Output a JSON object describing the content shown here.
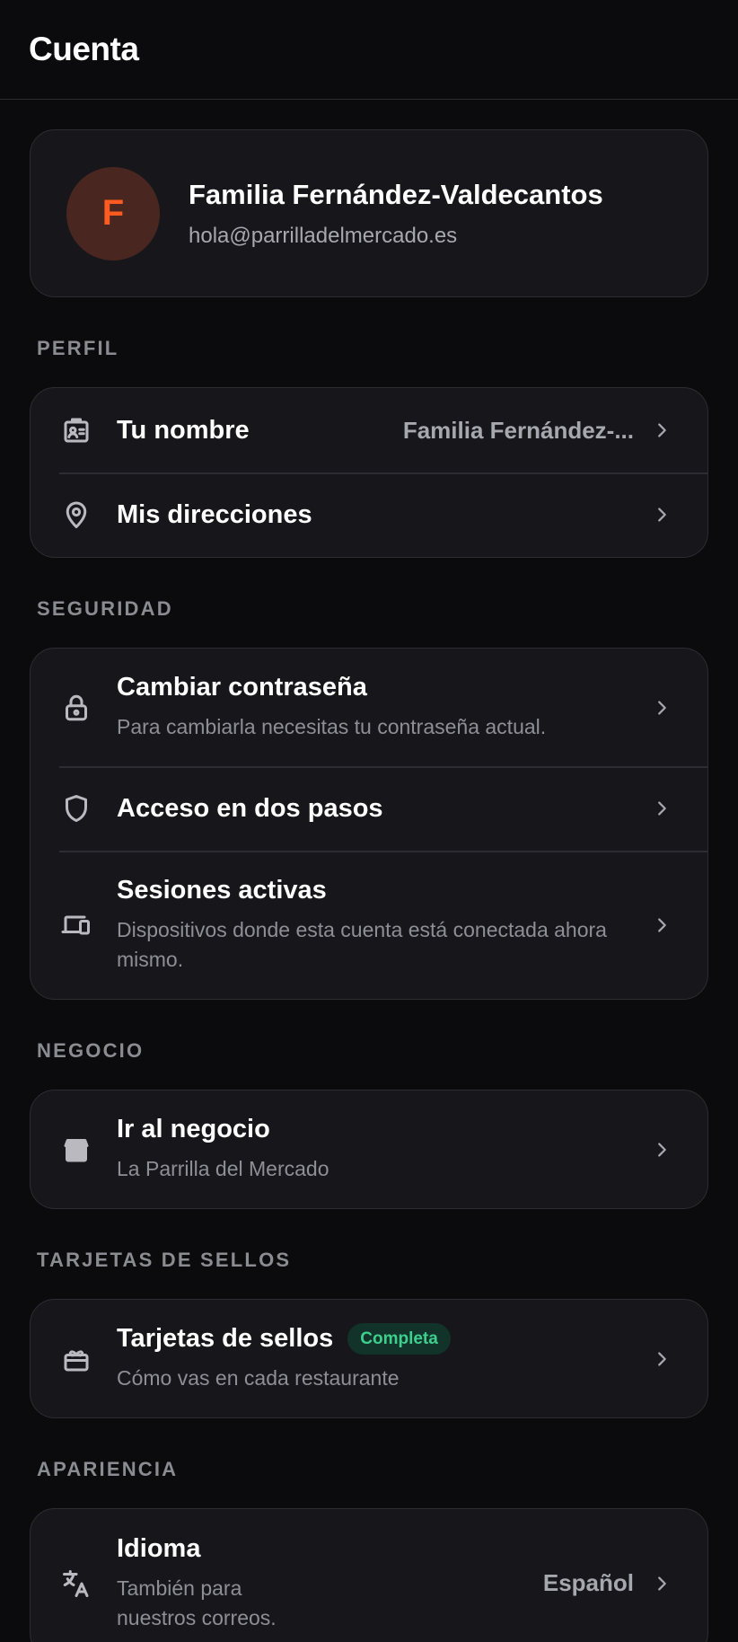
{
  "header": {
    "title": "Cuenta"
  },
  "profile": {
    "initial": "F",
    "name": "Familia Fernández-Valdecantos",
    "email": "hola@parrilladelmercado.es"
  },
  "perfil": {
    "label": "PERFIL",
    "items": [
      {
        "title": "Tu nombre",
        "value": "Familia Fernández-...",
        "icon": "id-badge-icon"
      },
      {
        "title": "Mis direcciones",
        "icon": "map-pin-icon"
      }
    ]
  },
  "seguridad": {
    "label": "SEGURIDAD",
    "items": [
      {
        "title": "Cambiar contraseña",
        "subtitle": "Para cambiarla necesitas tu contraseña actual.",
        "icon": "lock-icon"
      },
      {
        "title": "Acceso en dos pasos",
        "icon": "shield-icon"
      },
      {
        "title": "Sesiones activas",
        "subtitle": "Dispositivos donde esta cuenta está conectada ahora mismo.",
        "icon": "devices-icon"
      }
    ]
  },
  "negocio": {
    "label": "NEGOCIO",
    "items": [
      {
        "title": "Ir al negocio",
        "subtitle": "La Parrilla del Mercado",
        "icon": "store-icon"
      }
    ]
  },
  "tarjetas": {
    "label": "TARJETAS DE SELLOS",
    "items": [
      {
        "title": "Tarjetas de sellos",
        "badge": "Completa",
        "subtitle": "Cómo vas en cada restaurante",
        "icon": "gift-icon"
      }
    ]
  },
  "apariencia": {
    "label": "APARIENCIA",
    "items": [
      {
        "title": "Idioma",
        "subtitle": "También para nuestros correos.",
        "value": "Español",
        "icon": "translate-icon"
      }
    ]
  },
  "colors": {
    "background": "#0b0b0d",
    "card": "#17171b",
    "accent": "#ff5a1f",
    "badge_text": "#3ecf8e"
  }
}
